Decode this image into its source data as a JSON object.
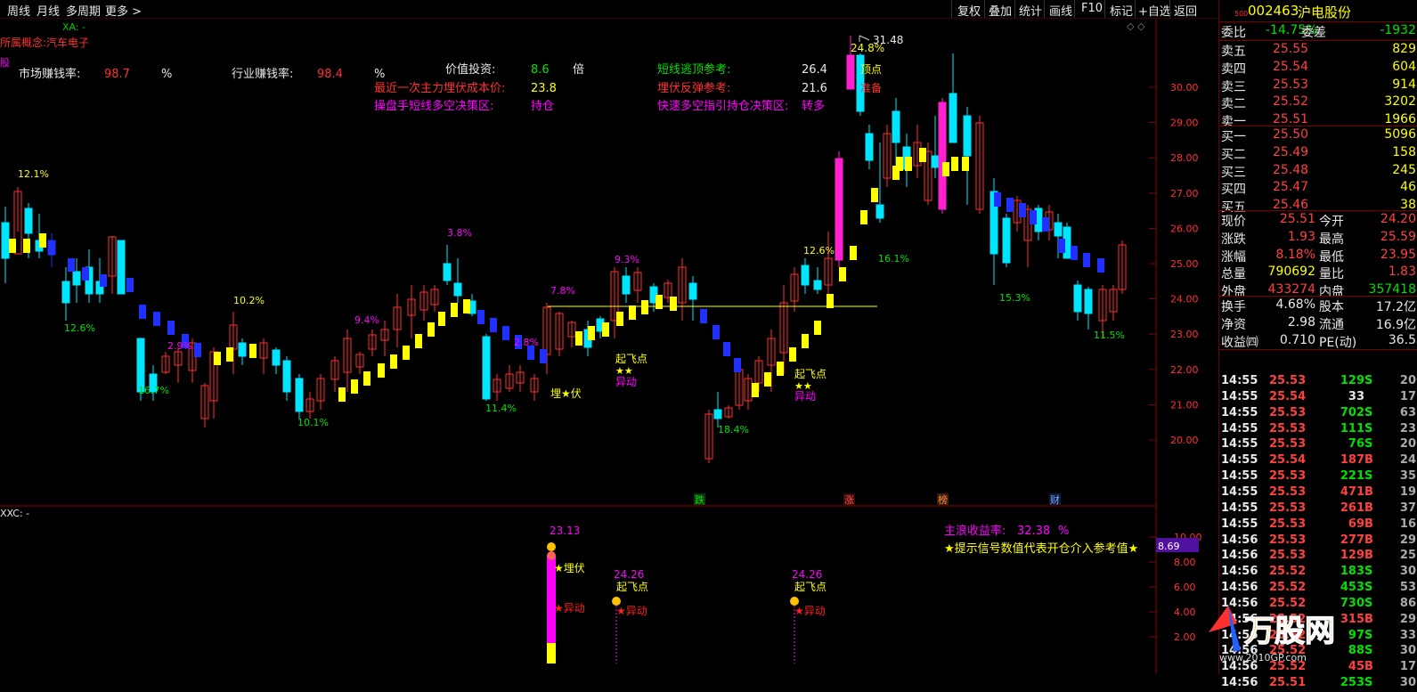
{
  "toolbar": {
    "left": [
      "周线",
      "月线",
      "多周期",
      "更多 >"
    ],
    "right": [
      "复权",
      "叠加",
      "统计",
      "画线",
      "F10",
      "标记",
      "+自选",
      "返回"
    ]
  },
  "info": {
    "concept": "所属概念:汽车电子",
    "xa_label": "XA: -",
    "side_tag": "股",
    "market_profit_label": "市场赚钱率:",
    "market_profit_value": "98.7",
    "pct1": "%",
    "industry_profit_label": "行业赚钱率:",
    "industry_profit_value": "98.4",
    "pct2": "%",
    "value_label": "价值投资:",
    "value_value": "8.6",
    "value_unit": "倍",
    "cost_label": "最近一次主力埋伏成本价:",
    "cost_value": "23.8",
    "trader_label": "操盘手短线多空决策区:",
    "trader_value": "持仓",
    "escape_label": "短线逃顶参考:",
    "escape_value": "26.4",
    "rebound_label": "埋伏反弹参考:",
    "rebound_value": "21.6",
    "fast_label": "快速多空指引持仓决策区:",
    "fast_value": "转多"
  },
  "chart_data": {
    "type": "candlestick",
    "y_ticks": [
      "30.00",
      "29.00",
      "28.00",
      "27.00",
      "26.00",
      "25.00",
      "24.00",
      "23.00",
      "22.00",
      "21.00",
      "20.00"
    ],
    "high_label": "31.48",
    "high_pct_label": "24.8%",
    "pct_labels": [
      {
        "text": "12.1%",
        "color": "#ffff00"
      },
      {
        "text": "12.6%",
        "color": "#00e000"
      },
      {
        "text": "16.7%",
        "color": "#00e000"
      },
      {
        "text": "2.9%",
        "color": "#ff00ff"
      },
      {
        "text": "10.2%",
        "color": "#ffff00"
      },
      {
        "text": "10.1%",
        "color": "#00e000"
      },
      {
        "text": "9.4%",
        "color": "#ff00ff"
      },
      {
        "text": "3.8%",
        "color": "#ff00ff"
      },
      {
        "text": "11.4%",
        "color": "#00e000"
      },
      {
        "text": "2.8%",
        "color": "#ff00ff"
      },
      {
        "text": "7.8%",
        "color": "#ff00ff"
      },
      {
        "text": "9.3%",
        "color": "#ff00ff"
      },
      {
        "text": "18.4%",
        "color": "#00e000"
      },
      {
        "text": "12.6%",
        "color": "#ffff00"
      },
      {
        "text": "16.1%",
        "color": "#00e000"
      },
      {
        "text": "15.3%",
        "color": "#00e000"
      },
      {
        "text": "11.5%",
        "color": "#00e000"
      }
    ],
    "signals": [
      "起飞点",
      "★★",
      "异动",
      "起飞点",
      "★★",
      "异动",
      "埋★伏",
      "顶点",
      "准备"
    ],
    "bottom_markers": [
      "跌",
      "涨",
      "榜",
      "财"
    ]
  },
  "sub_chart": {
    "label": "XXC: -",
    "y_ticks": [
      "10.00",
      "8.00",
      "6.00",
      "4.00",
      "2.00"
    ],
    "current_value": "8.69",
    "profit_label": "主浪收益率:",
    "profit_value": "32.38",
    "profit_pct": "%",
    "hint": "★提示信号数值代表开仓介入参考值★",
    "signals": [
      {
        "value": "23.13",
        "labels": [
          "★埋伏",
          "★异动"
        ]
      },
      {
        "value": "24.26",
        "labels": [
          "起飞点",
          "★异动"
        ]
      },
      {
        "value": "24.26",
        "labels": [
          "起飞点",
          "★异动"
        ]
      }
    ]
  },
  "quote": {
    "code": "002463",
    "name": "沪电股份",
    "small": "500",
    "weibi_label": "委比",
    "weibi_value": "-14.75%",
    "weicha_label": "委差",
    "weicha_value": "-1932",
    "asks": [
      {
        "label": "卖五",
        "price": "25.55",
        "vol": "829"
      },
      {
        "label": "卖四",
        "price": "25.54",
        "vol": "604"
      },
      {
        "label": "卖三",
        "price": "25.53",
        "vol": "914"
      },
      {
        "label": "卖二",
        "price": "25.52",
        "vol": "3202"
      },
      {
        "label": "卖一",
        "price": "25.51",
        "vol": "1966"
      }
    ],
    "bids": [
      {
        "label": "买一",
        "price": "25.50",
        "vol": "5096"
      },
      {
        "label": "买二",
        "price": "25.49",
        "vol": "158"
      },
      {
        "label": "买三",
        "price": "25.48",
        "vol": "245"
      },
      {
        "label": "买四",
        "price": "25.47",
        "vol": "46"
      },
      {
        "label": "买五",
        "price": "25.46",
        "vol": "38"
      }
    ],
    "stats": [
      {
        "l1": "现价",
        "v1": "25.51",
        "c1": "#ff4040",
        "l2": "今开",
        "v2": "24.20",
        "c2": "#ff4040"
      },
      {
        "l1": "涨跌",
        "v1": "1.93",
        "c1": "#ff4040",
        "l2": "最高",
        "v2": "25.59",
        "c2": "#ff4040"
      },
      {
        "l1": "涨幅",
        "v1": "8.18%",
        "c1": "#ff4040",
        "l2": "最低",
        "v2": "23.95",
        "c2": "#ff4040"
      },
      {
        "l1": "总量",
        "v1": "790692",
        "c1": "#ffff00",
        "l2": "量比",
        "v2": "1.83",
        "c2": "#ff4040"
      },
      {
        "l1": "外盘",
        "v1": "433274",
        "c1": "#ff4040",
        "l2": "内盘",
        "v2": "357418",
        "c2": "#00e000"
      }
    ],
    "stats2": [
      {
        "l1": "换手",
        "v1": "4.68%",
        "l2": "股本",
        "v2": "17.2亿"
      },
      {
        "l1": "净资",
        "v1": "2.98",
        "l2": "流通",
        "v2": "16.9亿"
      },
      {
        "l1": "收益㈣",
        "v1": "0.710",
        "l2": "PE(动)",
        "v2": "36.5"
      }
    ],
    "ticks": [
      {
        "t": "14:55",
        "p": "25.53",
        "v": "129",
        "s": "S",
        "n": "20"
      },
      {
        "t": "14:55",
        "p": "25.54",
        "v": "33",
        "s": "",
        "n": "17"
      },
      {
        "t": "14:55",
        "p": "25.53",
        "v": "702",
        "s": "S",
        "n": "63"
      },
      {
        "t": "14:55",
        "p": "25.53",
        "v": "111",
        "s": "S",
        "n": "23"
      },
      {
        "t": "14:55",
        "p": "25.53",
        "v": "76",
        "s": "S",
        "n": "20"
      },
      {
        "t": "14:55",
        "p": "25.54",
        "v": "187",
        "s": "B",
        "n": "24"
      },
      {
        "t": "14:55",
        "p": "25.53",
        "v": "221",
        "s": "S",
        "n": "35"
      },
      {
        "t": "14:55",
        "p": "25.53",
        "v": "471",
        "s": "B",
        "n": "19"
      },
      {
        "t": "14:55",
        "p": "25.53",
        "v": "261",
        "s": "B",
        "n": "37"
      },
      {
        "t": "14:55",
        "p": "25.53",
        "v": "69",
        "s": "B",
        "n": "16"
      },
      {
        "t": "14:56",
        "p": "25.53",
        "v": "277",
        "s": "B",
        "n": "29"
      },
      {
        "t": "14:56",
        "p": "25.53",
        "v": "129",
        "s": "B",
        "n": "25"
      },
      {
        "t": "14:56",
        "p": "25.52",
        "v": "183",
        "s": "S",
        "n": "30"
      },
      {
        "t": "14:56",
        "p": "25.52",
        "v": "453",
        "s": "S",
        "n": "53"
      },
      {
        "t": "14:56",
        "p": "25.52",
        "v": "730",
        "s": "S",
        "n": "86"
      },
      {
        "t": "14:56",
        "p": "25.52",
        "v": "315",
        "s": "B",
        "n": "29"
      },
      {
        "t": "14:56",
        "p": "25.52",
        "v": "97",
        "s": "S",
        "n": "33"
      },
      {
        "t": "14:56",
        "p": "25.52",
        "v": "88",
        "s": "S",
        "n": "30"
      },
      {
        "t": "14:56",
        "p": "25.52",
        "v": "45",
        "s": "B",
        "n": "17"
      },
      {
        "t": "14:56",
        "p": "25.51",
        "v": "253",
        "s": "S",
        "n": "30"
      }
    ],
    "watermark": "万股网",
    "watermark_url": "www.2010GP.com"
  }
}
